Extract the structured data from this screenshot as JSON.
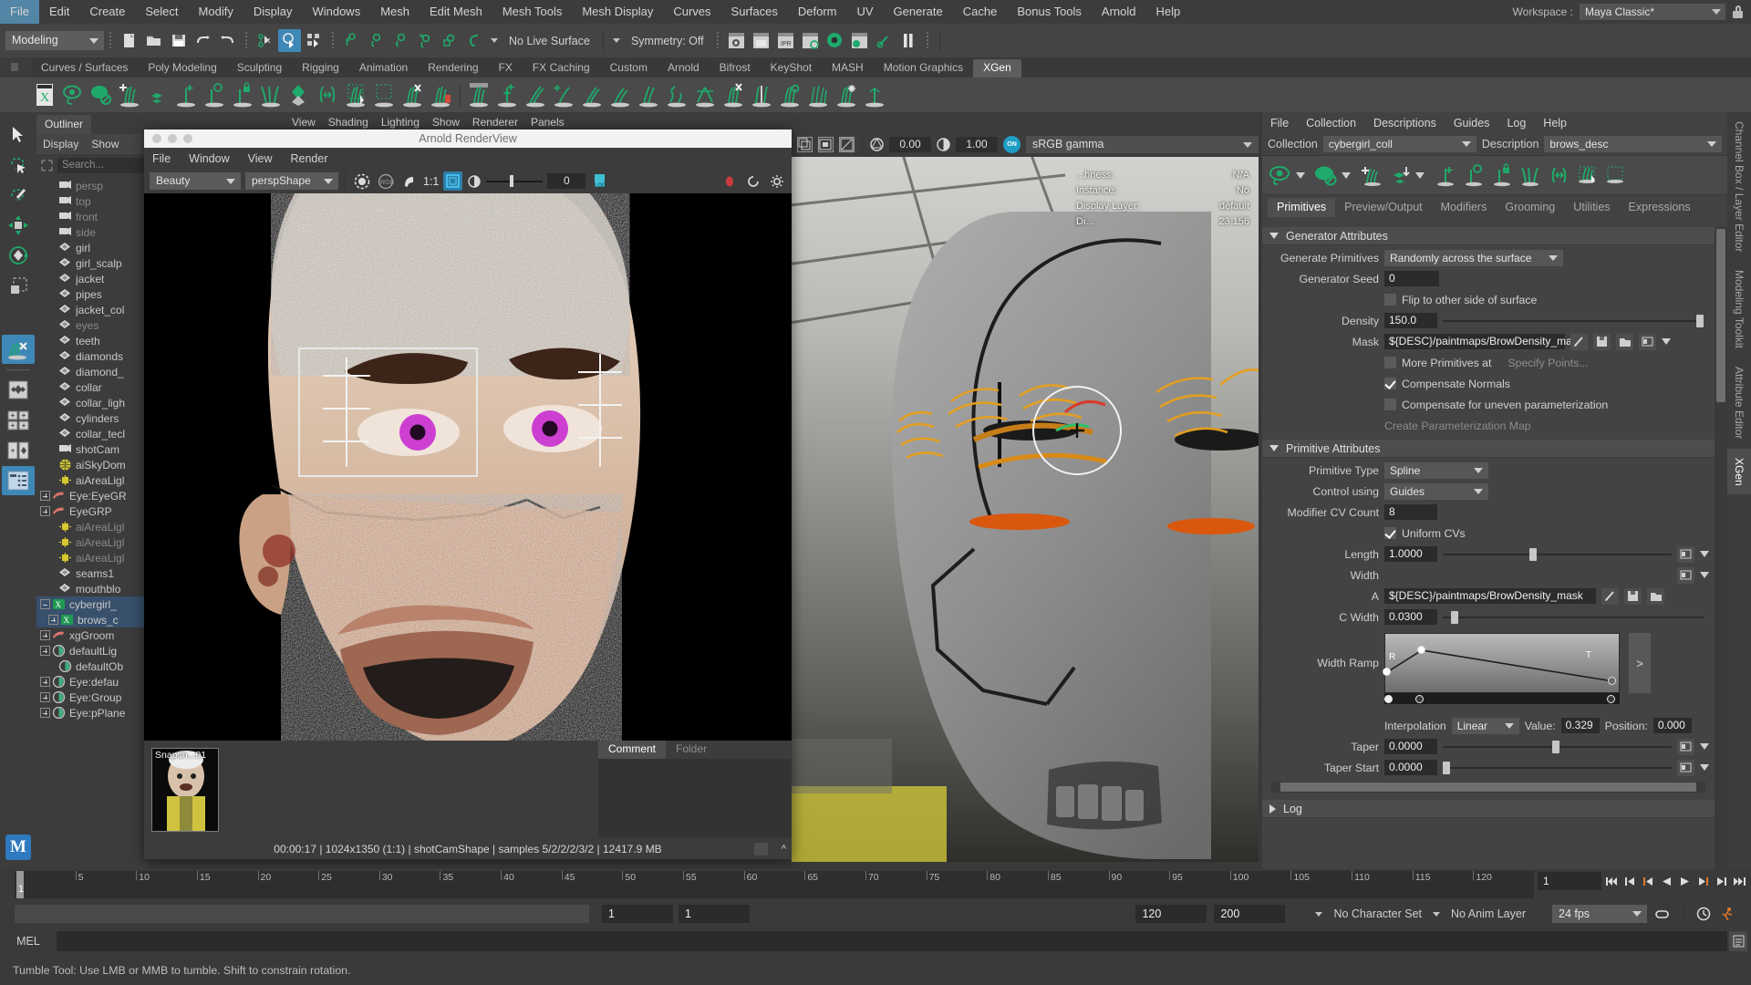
{
  "menubar": {
    "items": [
      "File",
      "Edit",
      "Create",
      "Select",
      "Modify",
      "Display",
      "Windows",
      "Mesh",
      "Edit Mesh",
      "Mesh Tools",
      "Mesh Display",
      "Curves",
      "Surfaces",
      "Deform",
      "UV",
      "Generate",
      "Cache",
      "Bonus Tools",
      "Arnold",
      "Help"
    ],
    "workspace_label": "Workspace :",
    "workspace_value": "Maya Classic*"
  },
  "statusline": {
    "mode": "Modeling",
    "live_surface": "No Live Surface",
    "symmetry": "Symmetry: Off"
  },
  "shelf": {
    "tabs": [
      "Curves / Surfaces",
      "Poly Modeling",
      "Sculpting",
      "Rigging",
      "Animation",
      "Rendering",
      "FX",
      "FX Caching",
      "Custom",
      "Arnold",
      "Bifrost",
      "KeyShot",
      "MASH",
      "Motion Graphics",
      "XGen"
    ],
    "active_tab": "XGen"
  },
  "outliner": {
    "tab": "Outliner",
    "menus": [
      "Display",
      "Show"
    ],
    "search_placeholder": "Search...",
    "items": [
      {
        "label": "persp",
        "icon": "camera-icon",
        "dim": true,
        "indent": 1
      },
      {
        "label": "top",
        "icon": "camera-icon",
        "dim": true,
        "indent": 1
      },
      {
        "label": "front",
        "icon": "camera-icon",
        "dim": true,
        "indent": 1
      },
      {
        "label": "side",
        "icon": "camera-icon",
        "dim": true,
        "indent": 1
      },
      {
        "label": "girl",
        "icon": "mesh-icon",
        "dim": false,
        "indent": 1
      },
      {
        "label": "girl_scalp",
        "icon": "mesh-icon",
        "dim": false,
        "indent": 1
      },
      {
        "label": "jacket",
        "icon": "mesh-icon",
        "dim": false,
        "indent": 1
      },
      {
        "label": "pipes",
        "icon": "mesh-icon",
        "dim": false,
        "indent": 1
      },
      {
        "label": "jacket_col",
        "icon": "mesh-icon",
        "dim": false,
        "indent": 1
      },
      {
        "label": "eyes",
        "icon": "mesh-icon",
        "dim": true,
        "indent": 1
      },
      {
        "label": "teeth",
        "icon": "mesh-icon",
        "dim": false,
        "indent": 1
      },
      {
        "label": "diamonds",
        "icon": "mesh-icon",
        "dim": false,
        "indent": 1
      },
      {
        "label": "diamond_",
        "icon": "mesh-icon",
        "dim": false,
        "indent": 1
      },
      {
        "label": "collar",
        "icon": "mesh-icon",
        "dim": false,
        "indent": 1
      },
      {
        "label": "collar_ligh",
        "icon": "mesh-icon",
        "dim": false,
        "indent": 1
      },
      {
        "label": "cylinders",
        "icon": "mesh-icon",
        "dim": false,
        "indent": 1
      },
      {
        "label": "collar_tecl",
        "icon": "mesh-icon",
        "dim": false,
        "indent": 1
      },
      {
        "label": "shotCam",
        "icon": "camera-icon",
        "dim": false,
        "indent": 1
      },
      {
        "label": "aiSkyDom",
        "icon": "skydome-icon",
        "dim": false,
        "indent": 1
      },
      {
        "label": "aiAreaLigl",
        "icon": "arealight-icon",
        "dim": false,
        "indent": 1
      },
      {
        "label": "Eye:EyeGR",
        "icon": "group-icon",
        "dim": false,
        "indent": 0,
        "expand": true
      },
      {
        "label": "EyeGRP",
        "icon": "group-icon",
        "dim": false,
        "indent": 0,
        "expand": true
      },
      {
        "label": "aiAreaLigl",
        "icon": "arealight-icon",
        "dim": true,
        "indent": 1
      },
      {
        "label": "aiAreaLigl",
        "icon": "arealight-icon",
        "dim": true,
        "indent": 1
      },
      {
        "label": "aiAreaLigl",
        "icon": "arealight-icon",
        "dim": true,
        "indent": 1
      },
      {
        "label": "seams1",
        "icon": "mesh-icon",
        "dim": false,
        "indent": 1
      },
      {
        "label": "mouthblo",
        "icon": "mesh-icon",
        "dim": false,
        "indent": 1
      },
      {
        "label": "cybergirl_",
        "icon": "xgen-icon",
        "dim": false,
        "indent": 0,
        "expand": true,
        "selected": true
      },
      {
        "label": "brows_c",
        "icon": "xgen-icon",
        "dim": false,
        "indent": 1,
        "expand": true,
        "selected": true
      },
      {
        "label": "xgGroom",
        "icon": "group-icon",
        "dim": false,
        "indent": 0,
        "expand": true
      },
      {
        "label": "defaultLig",
        "icon": "set-icon",
        "dim": false,
        "indent": 0,
        "expand": true
      },
      {
        "label": "defaultOb",
        "icon": "set-icon",
        "dim": false,
        "indent": 1
      },
      {
        "label": "Eye:defau",
        "icon": "set-icon",
        "dim": false,
        "indent": 0,
        "expand": true
      },
      {
        "label": "Eye:Group",
        "icon": "set-icon",
        "dim": false,
        "indent": 0,
        "expand": true
      },
      {
        "label": "Eye:pPlane",
        "icon": "set-icon",
        "dim": false,
        "indent": 0,
        "expand": true
      }
    ]
  },
  "viewport": {
    "menus": [
      "View",
      "Shading",
      "Lighting",
      "Show",
      "Renderer",
      "Panels"
    ],
    "near_clip": "0.00",
    "far_clip": "1.00",
    "color_space": "sRGB gamma",
    "hud": [
      {
        "k": "...hness:",
        "v": "N/A"
      },
      {
        "k": "Instance:",
        "v": "No"
      },
      {
        "k": "Display Layer:",
        "v": "default"
      },
      {
        "k": "Di...",
        "v": "23.156"
      }
    ]
  },
  "arnold": {
    "title": "Arnold RenderView",
    "menus": [
      "File",
      "Window",
      "View",
      "Render"
    ],
    "aov": "Beauty",
    "camera": "perspShape",
    "ratio": "1:1",
    "exposure": "0",
    "log_label": "LOG",
    "snapshot_label": "Snapsh...01",
    "comment_tab": "Comment",
    "folder_tab": "Folder",
    "status": "00:00:17 | 1024x1350 (1:1) | shotCamShape  | samples 5/2/2/2/3/2 | 12417.9 MB"
  },
  "xgen": {
    "menus": [
      "File",
      "Collection",
      "Descriptions",
      "Guides",
      "Log",
      "Help"
    ],
    "collection_label": "Collection",
    "collection_value": "cybergirl_coll",
    "description_label": "Description",
    "description_value": "brows_desc",
    "tabs": [
      "Primitives",
      "Preview/Output",
      "Modifiers",
      "Grooming",
      "Utilities",
      "Expressions"
    ],
    "active_tab": "Primitives",
    "generator": {
      "section": "Generator Attributes",
      "generate_primitives_label": "Generate Primitives",
      "generate_primitives_value": "Randomly across the surface",
      "generator_seed_label": "Generator Seed",
      "generator_seed_value": "0",
      "flip_label": "Flip to other side of surface",
      "flip_checked": false,
      "density_label": "Density",
      "density_value": "150.0",
      "mask_label": "Mask",
      "mask_value": "${DESC}/paintmaps/BrowDensity_mask",
      "more_primitives_label": "More Primitives at",
      "more_primitives_checked": false,
      "specify_points_label": "Specify Points...",
      "compensate_normals_label": "Compensate Normals",
      "compensate_normals_checked": true,
      "compensate_uneven_label": "Compensate for uneven parameterization",
      "compensate_uneven_checked": false,
      "create_param_map_label": "Create Parameterization Map"
    },
    "primitive": {
      "section": "Primitive Attributes",
      "primitive_type_label": "Primitive Type",
      "primitive_type_value": "Spline",
      "control_using_label": "Control using",
      "control_using_value": "Guides",
      "cv_count_label": "Modifier CV Count",
      "cv_count_value": "8",
      "uniform_cvs_label": "Uniform CVs",
      "uniform_cvs_checked": true,
      "length_label": "Length",
      "length_value": "1.0000",
      "width_label": "Width",
      "a_label": "A",
      "a_value": "${DESC}/paintmaps/BrowDensity_mask",
      "cwidth_label": "C Width",
      "cwidth_value": "0.0300",
      "width_ramp_label": "Width Ramp",
      "ramp_r_marker": "R",
      "ramp_t_marker": "T",
      "interpolation_label": "Interpolation",
      "interpolation_value": "Linear",
      "value_label": "Value:",
      "value_value": "0.329",
      "position_label": "Position:",
      "position_value": "0.000",
      "taper_label": "Taper",
      "taper_value": "0.0000",
      "taper_start_label": "Taper Start",
      "taper_start_value": "0.0000"
    },
    "log_section": "Log"
  },
  "vtabs": {
    "items": [
      "Channel Box / Layer Editor",
      "Modeling Toolkit",
      "Attribute Editor",
      "XGen"
    ],
    "active": "XGen"
  },
  "timeline": {
    "ticks": [
      "5",
      "10",
      "15",
      "20",
      "25",
      "30",
      "35",
      "40",
      "45",
      "50",
      "55",
      "60",
      "65",
      "70",
      "75",
      "80",
      "85",
      "90",
      "95",
      "100",
      "105",
      "110",
      "115",
      "120"
    ],
    "current_frame": "1",
    "playback_frame": "1",
    "range_start": "1",
    "range_end": "1",
    "anim_end": "120",
    "playback_end": "200",
    "character_set": "No Character Set",
    "anim_layer": "No Anim Layer",
    "fps": "24 fps"
  },
  "mel": {
    "label": "MEL"
  },
  "helpline": {
    "text": "Tumble Tool: Use LMB or MMB to tumble. Shift to constrain rotation."
  },
  "colors": {
    "accent": "#3e88b7",
    "xgen_green": "#1faa6b",
    "panel_bg": "#3c3c3c",
    "select_blue": "#38506b"
  }
}
